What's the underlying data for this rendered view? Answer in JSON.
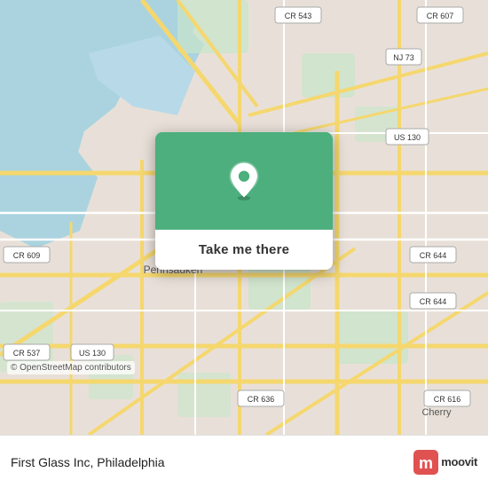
{
  "map": {
    "attribution": "© OpenStreetMap contributors",
    "accent_color": "#4caf7d",
    "background_color": "#e8e0d8"
  },
  "popup": {
    "button_label": "Take me there",
    "green_bg": "#4caf7d"
  },
  "bottom_bar": {
    "place_label": "First Glass Inc, Philadelphia",
    "moovit_brand": "moovit",
    "moovit_m": "m"
  }
}
